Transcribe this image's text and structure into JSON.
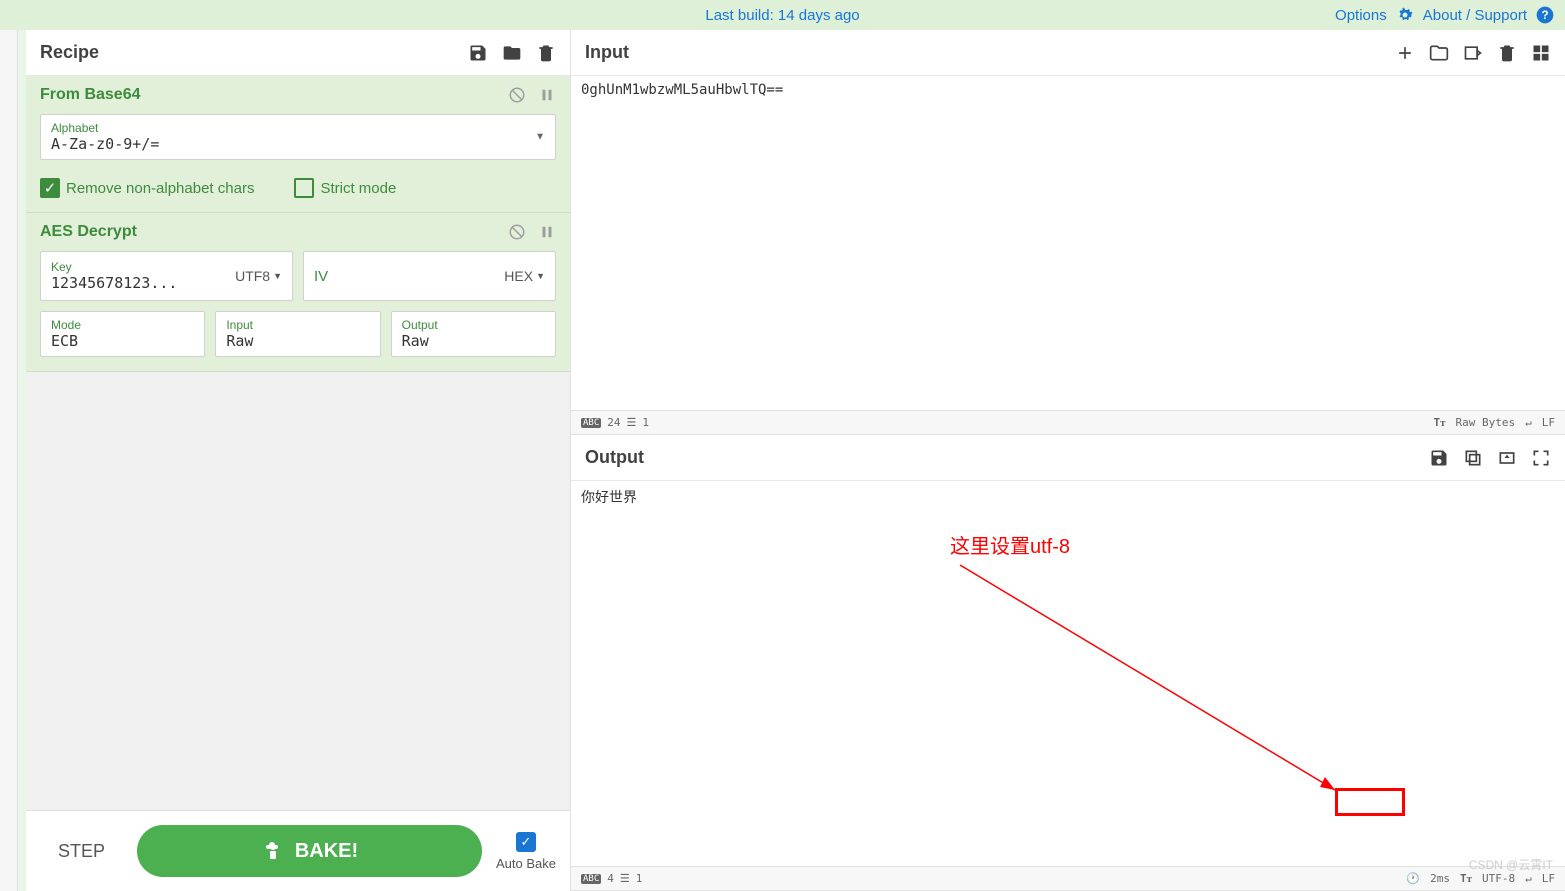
{
  "topbar": {
    "last_build": "Last build: 14 days ago",
    "options": "Options",
    "about": "About / Support"
  },
  "recipe": {
    "title": "Recipe",
    "ops": {
      "base64": {
        "name": "From Base64",
        "alphabet_label": "Alphabet",
        "alphabet_value": "A-Za-z0-9+/=",
        "remove_chars": "Remove non-alphabet chars",
        "strict_mode": "Strict mode"
      },
      "aes": {
        "name": "AES Decrypt",
        "key_label": "Key",
        "key_value": "12345678123...",
        "key_enc": "UTF8",
        "iv_label": "IV",
        "iv_enc": "HEX",
        "mode_label": "Mode",
        "mode_value": "ECB",
        "input_label": "Input",
        "input_value": "Raw",
        "output_label": "Output",
        "output_value": "Raw"
      }
    }
  },
  "bake": {
    "step": "STEP",
    "bake": "BAKE!",
    "autobake": "Auto Bake"
  },
  "input": {
    "title": "Input",
    "text": "0ghUnM1wbzwML5auHbwlTQ==",
    "status_chars": "24",
    "status_lines": "1",
    "status_enc": "Raw Bytes",
    "status_eol": "LF"
  },
  "output": {
    "title": "Output",
    "text": "你好世界",
    "status_chars": "4",
    "status_lines": "1",
    "status_time": "2ms",
    "status_enc": "UTF-8",
    "status_eol": "LF"
  },
  "annotation": {
    "text": "这里设置utf-8"
  },
  "watermark": "CSDN @云霄IT"
}
